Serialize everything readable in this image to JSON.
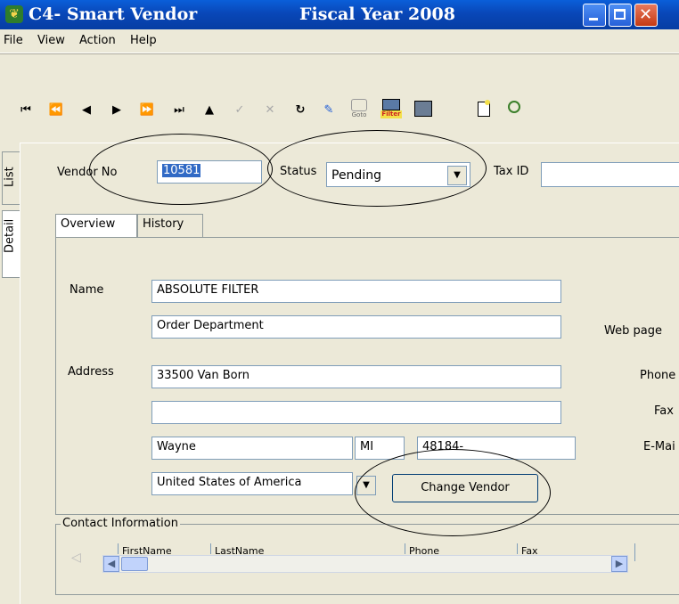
{
  "window": {
    "app_title": "C4- Smart Vendor",
    "fiscal_title": "Fiscal Year 2008"
  },
  "menu": [
    "File",
    "View",
    "Action",
    "Help"
  ],
  "side_tabs": {
    "list": "List",
    "detail": "Detail"
  },
  "header": {
    "vendor_no_label": "Vendor No",
    "vendor_no_value": "10581",
    "status_label": "Status",
    "status_value": "Pending",
    "tax_id_label": "Tax ID",
    "tax_id_value": ""
  },
  "tabs": {
    "overview": "Overview",
    "history": "History"
  },
  "form": {
    "name_label": "Name",
    "name_value": "ABSOLUTE FILTER",
    "name2_value": "Order Department",
    "address_label": "Address",
    "address1_value": "33500 Van Born",
    "address2_value": "",
    "city_value": "Wayne",
    "state_value": "MI",
    "zip_value": "48184-",
    "country_value": "United States of America",
    "change_vendor_label": "Change Vendor",
    "web_page_label": "Web page",
    "phone_label": "Phone",
    "fax_label": "Fax",
    "email_label": "E-Mai"
  },
  "contacts": {
    "group_label": "Contact Information",
    "columns": [
      "FirstName",
      "LastName",
      "Phone",
      "Fax"
    ]
  },
  "toolbar": {
    "goto_label": "Goto",
    "filter_label": "Filter"
  },
  "colors": {
    "titlebar": "#0947b8",
    "annotation": "#000000"
  }
}
